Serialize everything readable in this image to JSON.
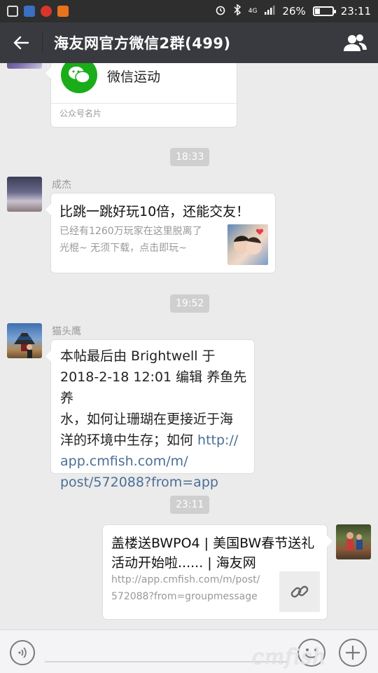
{
  "status_bar": {
    "battery_percent": "26%",
    "battery_level": 0.26,
    "time": "23:11",
    "signal_label": "4G"
  },
  "header": {
    "title": "海友网官方微信2群(499)",
    "back_icon": "back-arrow-icon",
    "members_icon": "group-members-icon"
  },
  "messages": {
    "card": {
      "name": "微信运动",
      "footer": "公众号名片",
      "icon_color": "#1aad19"
    },
    "time1": "18:33",
    "msg1": {
      "sender": "成杰",
      "title": "比跳一跳好玩10倍，还能交友！",
      "desc_line1": "已经有1260万玩家在这里脱离了",
      "desc_line2": "光棍~ 无须下载，点击即玩~"
    },
    "time2": "19:52",
    "msg2": {
      "sender": "猫头鹰",
      "line1": "本帖最后由 Brightwell 于",
      "line2": "2018-2-18 12:01 编辑 养鱼先养",
      "line3": "水，如何让珊瑚在更接近于海",
      "line4_text": "洋的环境中生存；如何 ",
      "line4_link": "http://",
      "line5": "app.cmfish.com/m/",
      "line6": "post/572088?from=app"
    },
    "time3": "23:11",
    "msg3": {
      "title_line1": "盖楼送BWPO4 | 美国BW春节送礼",
      "title_line2": "活动开始啦...... | 海友网",
      "desc_line1": "http://app.cmfish.com/m/post/",
      "desc_line2": "572088?from=groupmessage",
      "thumb_icon": "link-icon"
    }
  },
  "input_bar": {
    "voice_icon": "voice-icon",
    "emoji_icon": "emoji-icon",
    "plus_icon": "plus-icon"
  },
  "watermark": "cmfish"
}
